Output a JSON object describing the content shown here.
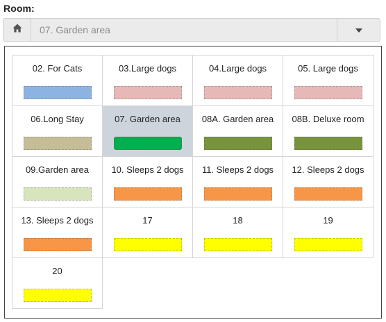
{
  "header": {
    "label": "Room:"
  },
  "select": {
    "icon": "home-icon",
    "value": "07. Garden area",
    "caret_icon": "caret-down-icon"
  },
  "rooms": [
    {
      "name": "02. For Cats",
      "color": "#8db3e2",
      "selected": false
    },
    {
      "name": "03.Large dogs",
      "color": "#e6b8b7",
      "selected": false
    },
    {
      "name": "04.Large dogs",
      "color": "#e6b8b7",
      "selected": false
    },
    {
      "name": "05. Large dogs",
      "color": "#e6b8b7",
      "selected": false
    },
    {
      "name": "06.Long Stay",
      "color": "#c4bd97",
      "selected": false
    },
    {
      "name": "07. Garden area",
      "color": "#00b050",
      "selected": true
    },
    {
      "name": "08A. Garden area",
      "color": "#77933c",
      "selected": false
    },
    {
      "name": "08B. Deluxe room",
      "color": "#77933c",
      "selected": false
    },
    {
      "name": "09.Garden area",
      "color": "#d7e4bc",
      "selected": false
    },
    {
      "name": "10. Sleeps 2 dogs",
      "color": "#f79646",
      "selected": false
    },
    {
      "name": "11. Sleeps 2 dogs",
      "color": "#f79646",
      "selected": false
    },
    {
      "name": "12. Sleeps 2 dogs",
      "color": "#f79646",
      "selected": false
    },
    {
      "name": "13. Sleeps 2 dogs",
      "color": "#f79646",
      "selected": false
    },
    {
      "name": "17",
      "color": "#ffff00",
      "selected": false
    },
    {
      "name": "18",
      "color": "#ffff00",
      "selected": false
    },
    {
      "name": "19",
      "color": "#ffff00",
      "selected": false
    },
    {
      "name": "20",
      "color": "#ffff00",
      "selected": false
    }
  ]
}
